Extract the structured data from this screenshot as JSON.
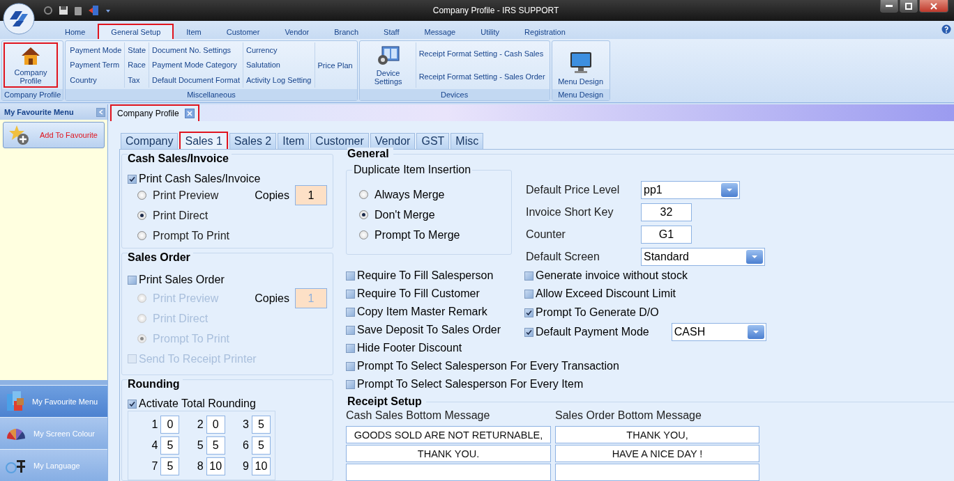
{
  "window": {
    "title": "Company Profile - IRS SUPPORT"
  },
  "ribbon_tabs": [
    {
      "label": "Home",
      "selected": false,
      "highlighted": false
    },
    {
      "label": "General Setup",
      "selected": true,
      "highlighted": true
    },
    {
      "label": "Item",
      "selected": false,
      "highlighted": false
    },
    {
      "label": "Customer",
      "selected": false,
      "highlighted": false
    },
    {
      "label": "Vendor",
      "selected": false,
      "highlighted": false
    },
    {
      "label": "Branch",
      "selected": false,
      "highlighted": false
    },
    {
      "label": "Staff",
      "selected": false,
      "highlighted": false
    },
    {
      "label": "Message",
      "selected": false,
      "highlighted": false
    },
    {
      "label": "Utility",
      "selected": false,
      "highlighted": false
    },
    {
      "label": "Registration",
      "selected": false,
      "highlighted": false
    }
  ],
  "ribbon_groups": [
    {
      "title": "Company Profile",
      "big_button": {
        "label": "Company Profile",
        "kind": "house",
        "highlighted": true
      }
    },
    {
      "title": "Miscellaneous",
      "columns": [
        [
          "Payment Mode",
          "Payment Term",
          "Country"
        ],
        [
          "State",
          "Race",
          "Tax"
        ],
        [
          "Document No. Settings",
          "Payment Mode Category",
          "Default Document Format"
        ],
        [
          "Currency",
          "Salutation",
          "Activity Log Setting"
        ],
        [
          "Price Plan"
        ]
      ]
    },
    {
      "title": "Devices",
      "big_button": {
        "label": "Device Settings",
        "kind": "device",
        "highlighted": false
      },
      "columns": [
        [
          "Receipt Format Setting - Cash  Sales",
          "Receipt Format Setting - Sales Order"
        ]
      ]
    },
    {
      "title": "Menu Design",
      "big_button": {
        "label": "Menu Design",
        "kind": "monitor",
        "highlighted": false
      }
    }
  ],
  "sidebar": {
    "title": "My Favourite Menu",
    "add_button": "Add To Favourite",
    "nav": [
      {
        "label": "My Favourite Menu",
        "kind": "cubes"
      },
      {
        "label": "My Screen Colour",
        "kind": "fan"
      },
      {
        "label": "My Language",
        "kind": "globe"
      }
    ]
  },
  "doc_tabs": [
    {
      "label": "Company Profile",
      "highlighted": true
    }
  ],
  "settings_tabs": [
    {
      "label": "Company",
      "selected": false,
      "highlighted": false
    },
    {
      "label": "Sales 1",
      "selected": true,
      "highlighted": true
    },
    {
      "label": "Sales 2",
      "selected": false,
      "highlighted": false
    },
    {
      "label": "Item",
      "selected": false,
      "highlighted": false
    },
    {
      "label": "Customer",
      "selected": false,
      "highlighted": false
    },
    {
      "label": "Vendor",
      "selected": false,
      "highlighted": false
    },
    {
      "label": "GST",
      "selected": false,
      "highlighted": false
    },
    {
      "label": "Misc",
      "selected": false,
      "highlighted": false
    }
  ],
  "cash_sales": {
    "title": "Cash Sales/Invoice",
    "print": {
      "label": "Print Cash Sales/Invoice",
      "checked": true
    },
    "options": [
      {
        "label": "Print Preview",
        "selected": false
      },
      {
        "label": "Print Direct",
        "selected": true
      },
      {
        "label": "Prompt To Print",
        "selected": false
      }
    ],
    "copies_label": "Copies",
    "copies": "1",
    "disabled": false
  },
  "sales_order": {
    "title": "Sales Order",
    "print": {
      "label": "Print Sales Order",
      "checked": false
    },
    "options": [
      {
        "label": "Print Preview",
        "selected": false
      },
      {
        "label": "Print Direct",
        "selected": false
      },
      {
        "label": "Prompt To Print",
        "selected": true
      }
    ],
    "copies_label": "Copies",
    "copies": "1",
    "disabled": true,
    "receipt_printer": {
      "label": "Send To Receipt Printer",
      "checked": false,
      "disabled": true
    }
  },
  "rounding": {
    "title": "Rounding",
    "activate": {
      "label": "Activate Total Rounding",
      "checked": true
    },
    "cells": [
      {
        "label": "1",
        "value": "0"
      },
      {
        "label": "2",
        "value": "0"
      },
      {
        "label": "3",
        "value": "5"
      },
      {
        "label": "4",
        "value": "5"
      },
      {
        "label": "5",
        "value": "5"
      },
      {
        "label": "6",
        "value": "5"
      },
      {
        "label": "7",
        "value": "5"
      },
      {
        "label": "8",
        "value": "10"
      },
      {
        "label": "9",
        "value": "10"
      }
    ]
  },
  "general": {
    "title": "General",
    "duplicate": {
      "title": "Duplicate Item Insertion",
      "options": [
        {
          "label": "Always Merge",
          "selected": false
        },
        {
          "label": "Don't Merge",
          "selected": true
        },
        {
          "label": "Prompt To Merge",
          "selected": false
        }
      ]
    },
    "fields": [
      {
        "label": "Default Price Level",
        "value": "pp1",
        "kind": "select"
      },
      {
        "label": "Invoice Short Key",
        "value": "32",
        "kind": "text"
      },
      {
        "label": "Counter",
        "value": "G1",
        "kind": "text"
      },
      {
        "label": "Default Screen",
        "value": "Standard",
        "kind": "select"
      }
    ],
    "checks_left": [
      {
        "label": "Require To Fill Salesperson",
        "checked": false
      },
      {
        "label": "Require To Fill Customer",
        "checked": false
      },
      {
        "label": "Copy Item Master Remark",
        "checked": false
      },
      {
        "label": "Save Deposit To Sales Order",
        "checked": false
      },
      {
        "label": "Hide Footer Discount",
        "checked": false
      },
      {
        "label": "Prompt To Select Salesperson For Every Transaction",
        "checked": false
      },
      {
        "label": "Prompt To Select Salesperson For Every Item",
        "checked": false
      }
    ],
    "checks_right": [
      {
        "label": "Generate invoice without stock",
        "checked": false
      },
      {
        "label": "Allow Exceed Discount Limit",
        "checked": false
      },
      {
        "label": "Prompt To Generate D/O",
        "checked": true
      },
      {
        "label": "Default Payment Mode",
        "checked": true,
        "select": "CASH"
      }
    ]
  },
  "receipt": {
    "title": "Receipt Setup",
    "columns": [
      {
        "label": "Cash Sales Bottom Message",
        "lines": [
          "GOODS SOLD ARE NOT RETURNABLE,",
          "THANK YOU."
        ]
      },
      {
        "label": "Sales Order Bottom Message",
        "lines": [
          "THANK YOU,",
          "HAVE A NICE DAY !"
        ]
      }
    ]
  }
}
